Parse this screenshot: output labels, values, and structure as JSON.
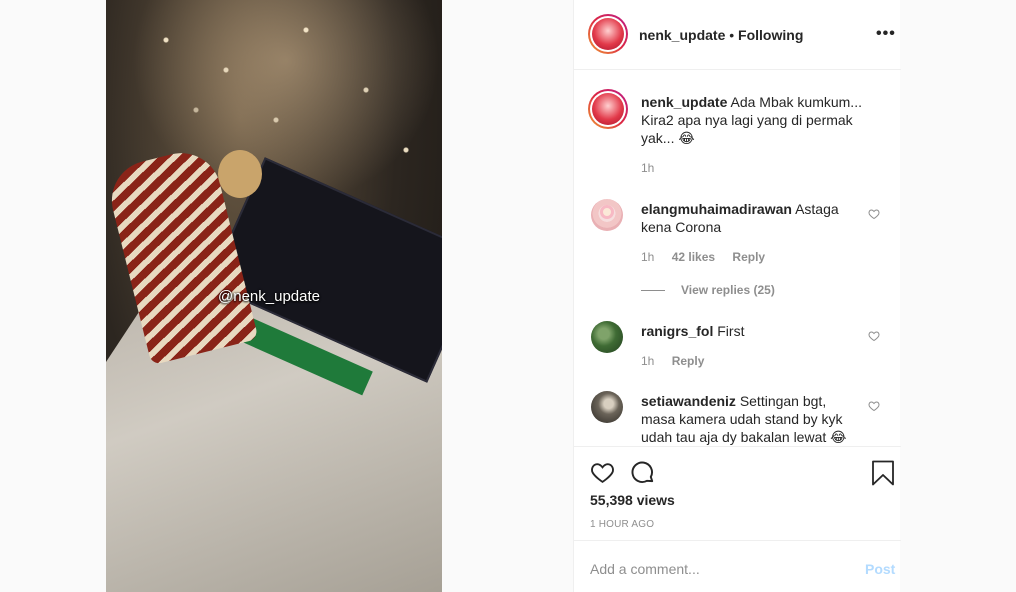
{
  "video": {
    "watermark": "@nenk_update"
  },
  "header": {
    "username": "nenk_update",
    "separator": "•",
    "follow_status": "Following",
    "more_icon": "more-horizontal-icon"
  },
  "caption": {
    "username": "nenk_update",
    "text": "Ada Mbak kumkum... Kira2 apa nya lagi yang di permak yak... 😂",
    "time": "1h"
  },
  "comments": [
    {
      "username": "elangmuhaimadirawan",
      "text": "Astaga kena Corona",
      "time": "1h",
      "likes": "42 likes",
      "reply": "Reply",
      "view_replies": "View replies (25)"
    },
    {
      "username": "ranigrs_fol",
      "text": "First",
      "time": "1h",
      "reply": "Reply"
    },
    {
      "username": "setiawandeniz",
      "text": "Settingan bgt, masa kamera udah stand by kyk udah tau aja dy bakalan lewat 😂"
    }
  ],
  "stats": {
    "views": "55,398 views",
    "posted": "1 HOUR AGO"
  },
  "composer": {
    "placeholder": "Add a comment...",
    "post_label": "Post"
  },
  "colors": {
    "post_disabled": "#b3dbff",
    "muted": "#8e8e8e",
    "border": "#efefef"
  }
}
